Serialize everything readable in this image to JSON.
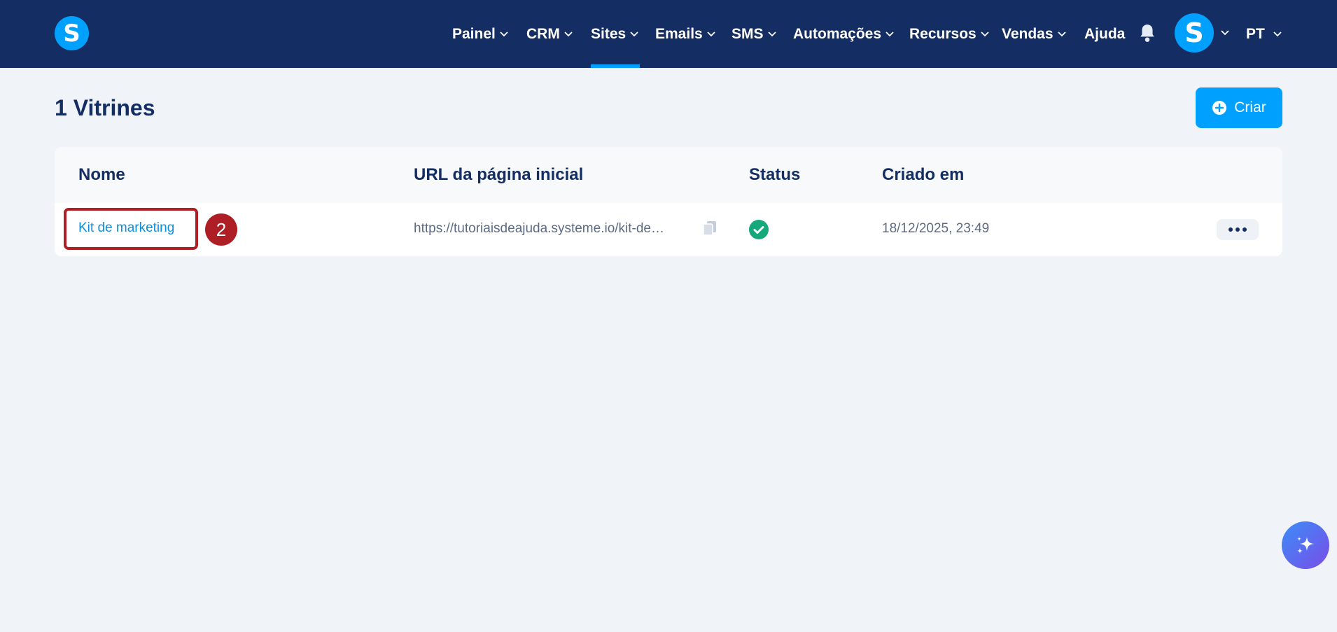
{
  "app": {
    "logo_letter": "S",
    "avatar_letter": "S"
  },
  "nav": {
    "items": [
      {
        "label": "Painel"
      },
      {
        "label": "CRM"
      },
      {
        "label": "Sites"
      },
      {
        "label": "Emails"
      },
      {
        "label": "SMS"
      },
      {
        "label": "Automações"
      },
      {
        "label": "Recursos"
      },
      {
        "label": "Vendas"
      },
      {
        "label": "Ajuda"
      }
    ],
    "active": "Sites",
    "language": "PT"
  },
  "header": {
    "title": "1 Vitrines",
    "create_label": "Criar"
  },
  "table": {
    "columns": [
      "Nome",
      "URL da página inicial",
      "Status",
      "Criado em"
    ],
    "rows": [
      {
        "name": "Kit de marketing",
        "url": "https://tutoriaisdeajuda.systeme.io/kit-de…",
        "status": "active",
        "created": "18/12/2025, 23:49"
      }
    ]
  },
  "annotation": {
    "step": "2"
  },
  "colors": {
    "nav_bg": "#142d63",
    "accent": "#00a0ff",
    "annotation": "#ad1f24",
    "status_ok": "#15a87a"
  }
}
